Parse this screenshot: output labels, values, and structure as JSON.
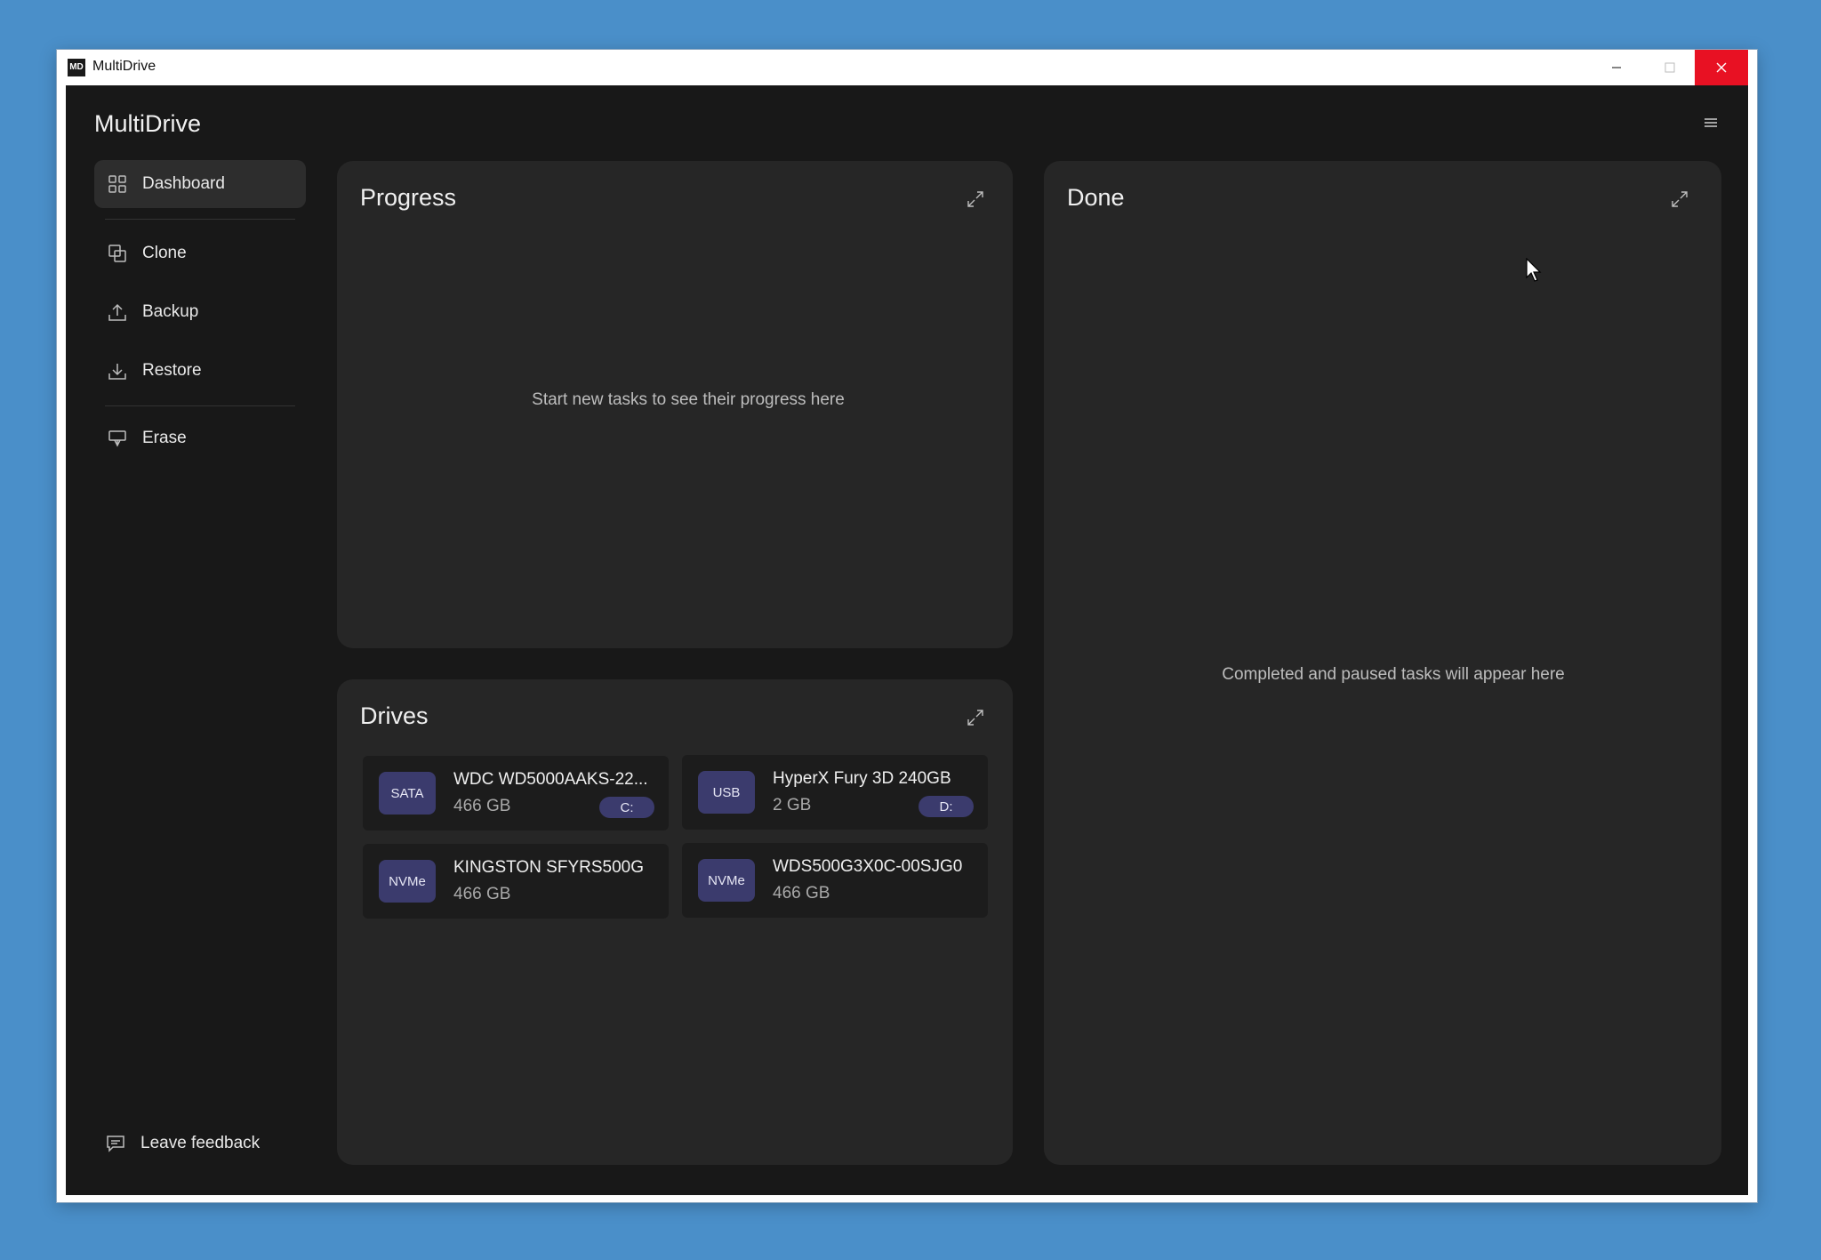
{
  "window": {
    "title": "MultiDrive",
    "icon_label": "MD",
    "controls": [
      "minimize-icon",
      "maximize-icon",
      "close-icon"
    ]
  },
  "app": {
    "title": "MultiDrive",
    "menu_icon": "hamburger-menu-icon"
  },
  "sidebar": {
    "items": [
      {
        "label": "Dashboard",
        "icon": "grid-icon",
        "active": true
      },
      {
        "label": "Clone",
        "icon": "copy-icon"
      },
      {
        "label": "Backup",
        "icon": "upload-icon"
      },
      {
        "label": "Restore",
        "icon": "download-icon"
      },
      {
        "label": "Erase",
        "icon": "erase-icon"
      }
    ],
    "feedback": {
      "label": "Leave feedback",
      "icon": "feedback-icon"
    }
  },
  "progress": {
    "title": "Progress",
    "empty_text": "Start new tasks to see their progress here"
  },
  "done": {
    "title": "Done",
    "empty_text": "Completed and paused tasks will appear here"
  },
  "drives": {
    "title": "Drives",
    "items": [
      {
        "type": "SATA",
        "name": "WDC WD5000AAKS-22...",
        "size": "466 GB",
        "letter": "C:"
      },
      {
        "type": "USB",
        "name": "HyperX Fury 3D 240GB",
        "size": "2 GB",
        "letter": "D:"
      },
      {
        "type": "NVMe",
        "name": "KINGSTON SFYRS500G",
        "size": "466 GB",
        "letter": ""
      },
      {
        "type": "NVMe",
        "name": "WDS500G3X0C-00SJG0",
        "size": "466 GB",
        "letter": ""
      }
    ]
  },
  "colors": {
    "desktop": "#4a8fc9",
    "app_background": "#181818",
    "card_background": "#262626",
    "badge": "#3b3b6d",
    "close_button": "#e81123"
  }
}
